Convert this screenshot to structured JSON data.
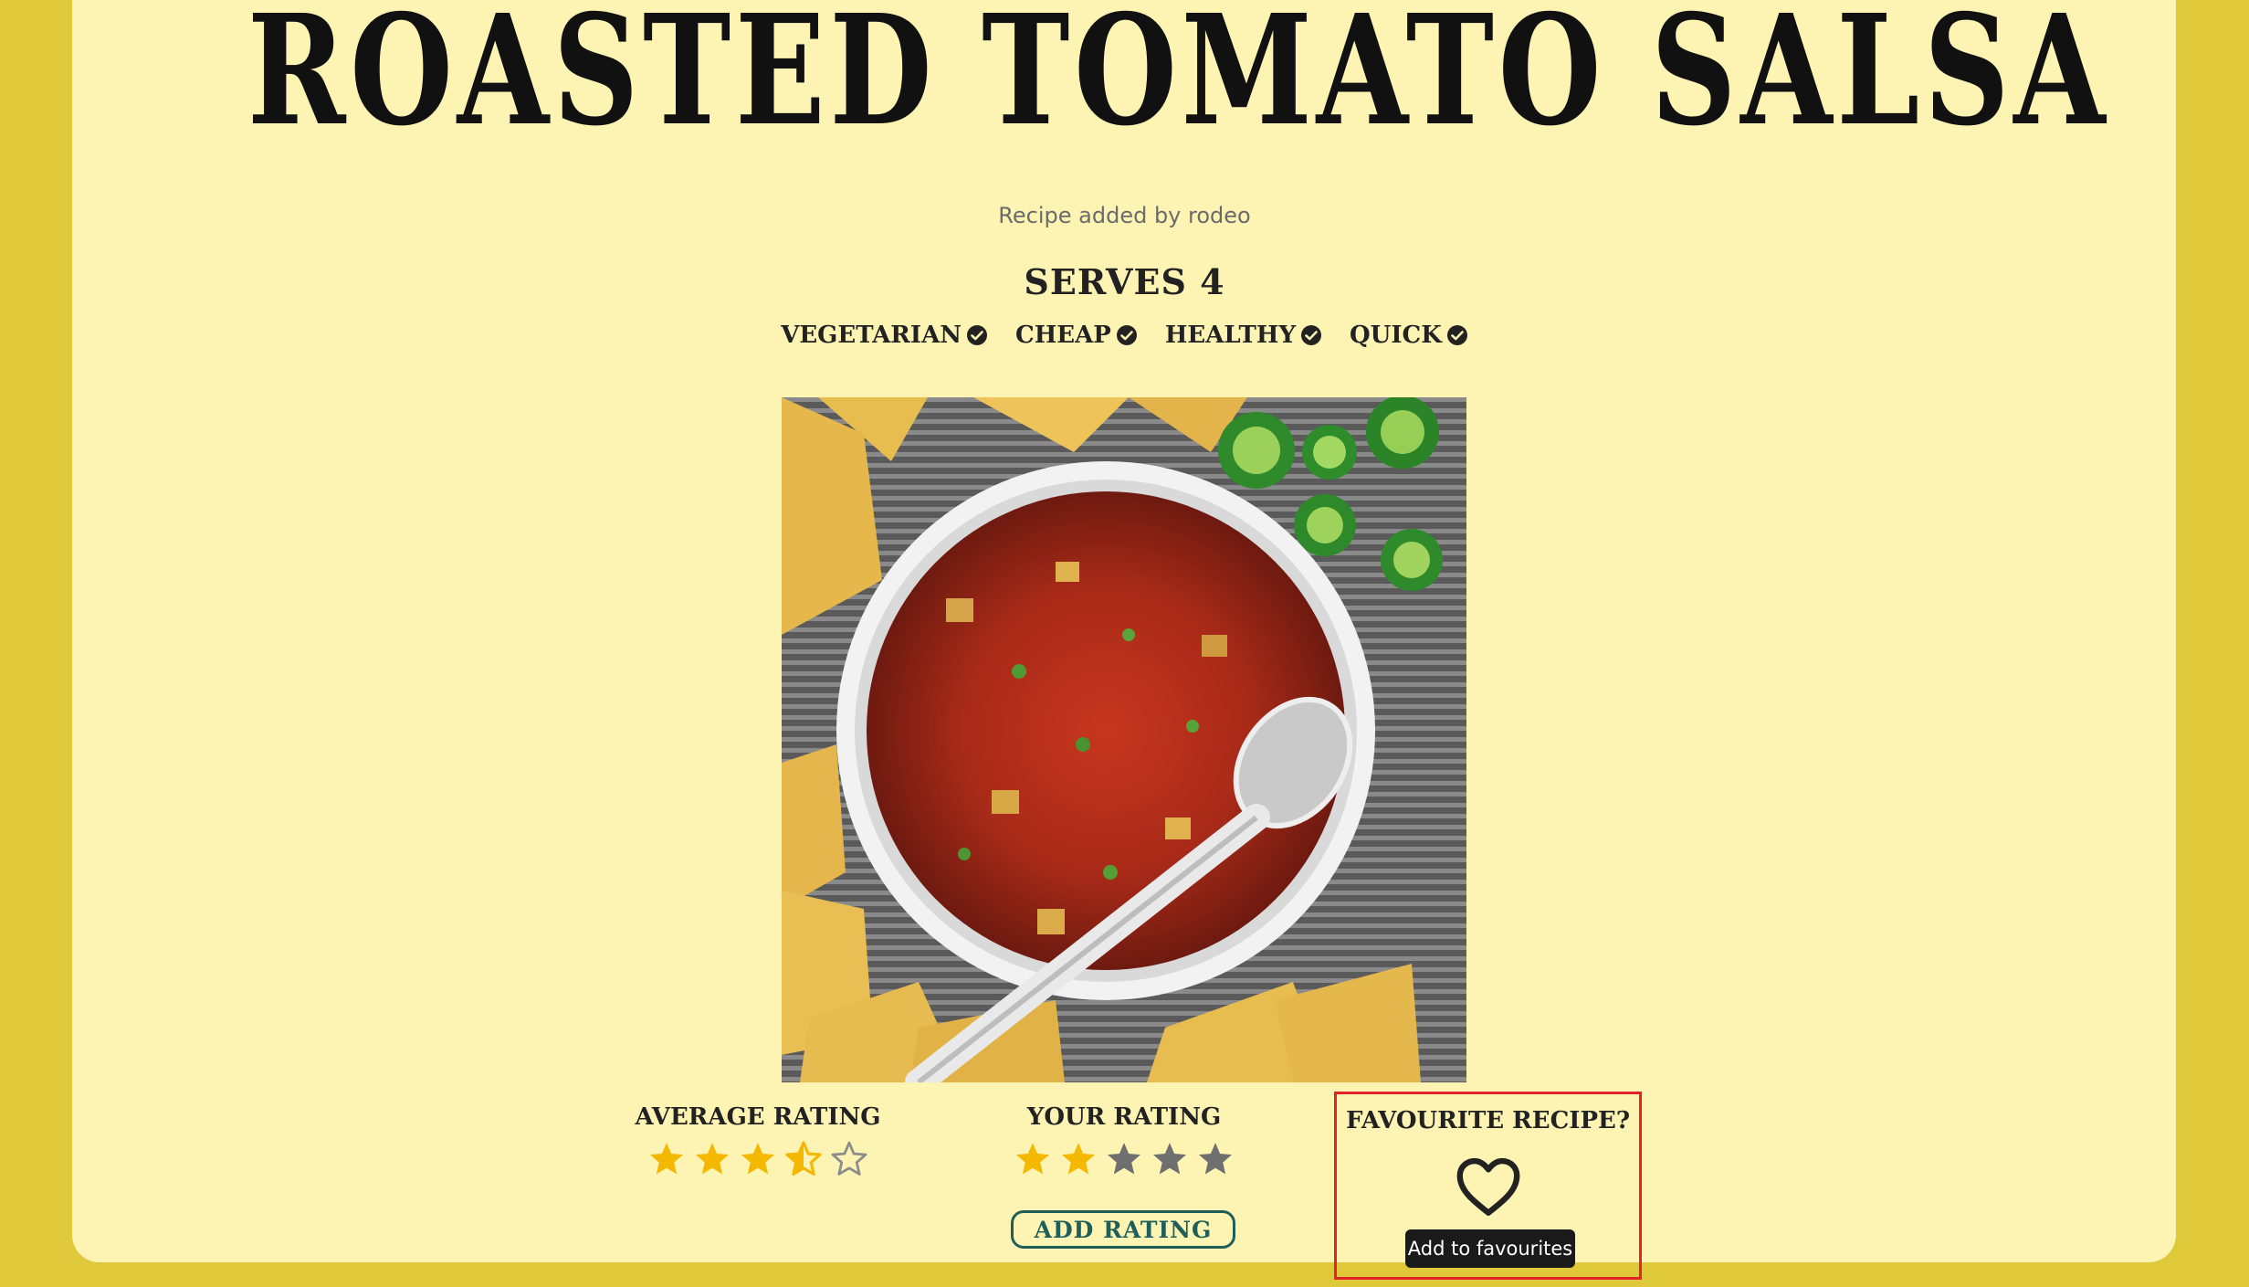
{
  "recipe": {
    "title": "ROASTED TOMATO SALSA",
    "added_by": "Recipe added by rodeo",
    "serves": "SERVES 4",
    "tags": [
      "VEGETARIAN",
      "CHEAP",
      "HEALTHY",
      "QUICK"
    ]
  },
  "average_rating": {
    "heading": "AVERAGE RATING",
    "value": 3.5,
    "max": 5
  },
  "your_rating": {
    "heading": "YOUR RATING",
    "value": 2,
    "max": 5,
    "button_label": "ADD RATING"
  },
  "favourite": {
    "heading": "FAVOURITE RECIPE?",
    "tooltip": "Add to favourites",
    "icon": "heart-outline-icon"
  },
  "colors": {
    "page_background": "#dfc83a",
    "card_background": "#fdf4b4",
    "star_filled": "#f5b800",
    "star_empty_gray": "#6f6f6f",
    "button_accent": "#1f5e5a",
    "highlight_border": "#e2232a"
  },
  "icons": {
    "tag_check": "check-circle-icon",
    "star": "star-icon",
    "photo": "salsa-bowl-photo"
  }
}
